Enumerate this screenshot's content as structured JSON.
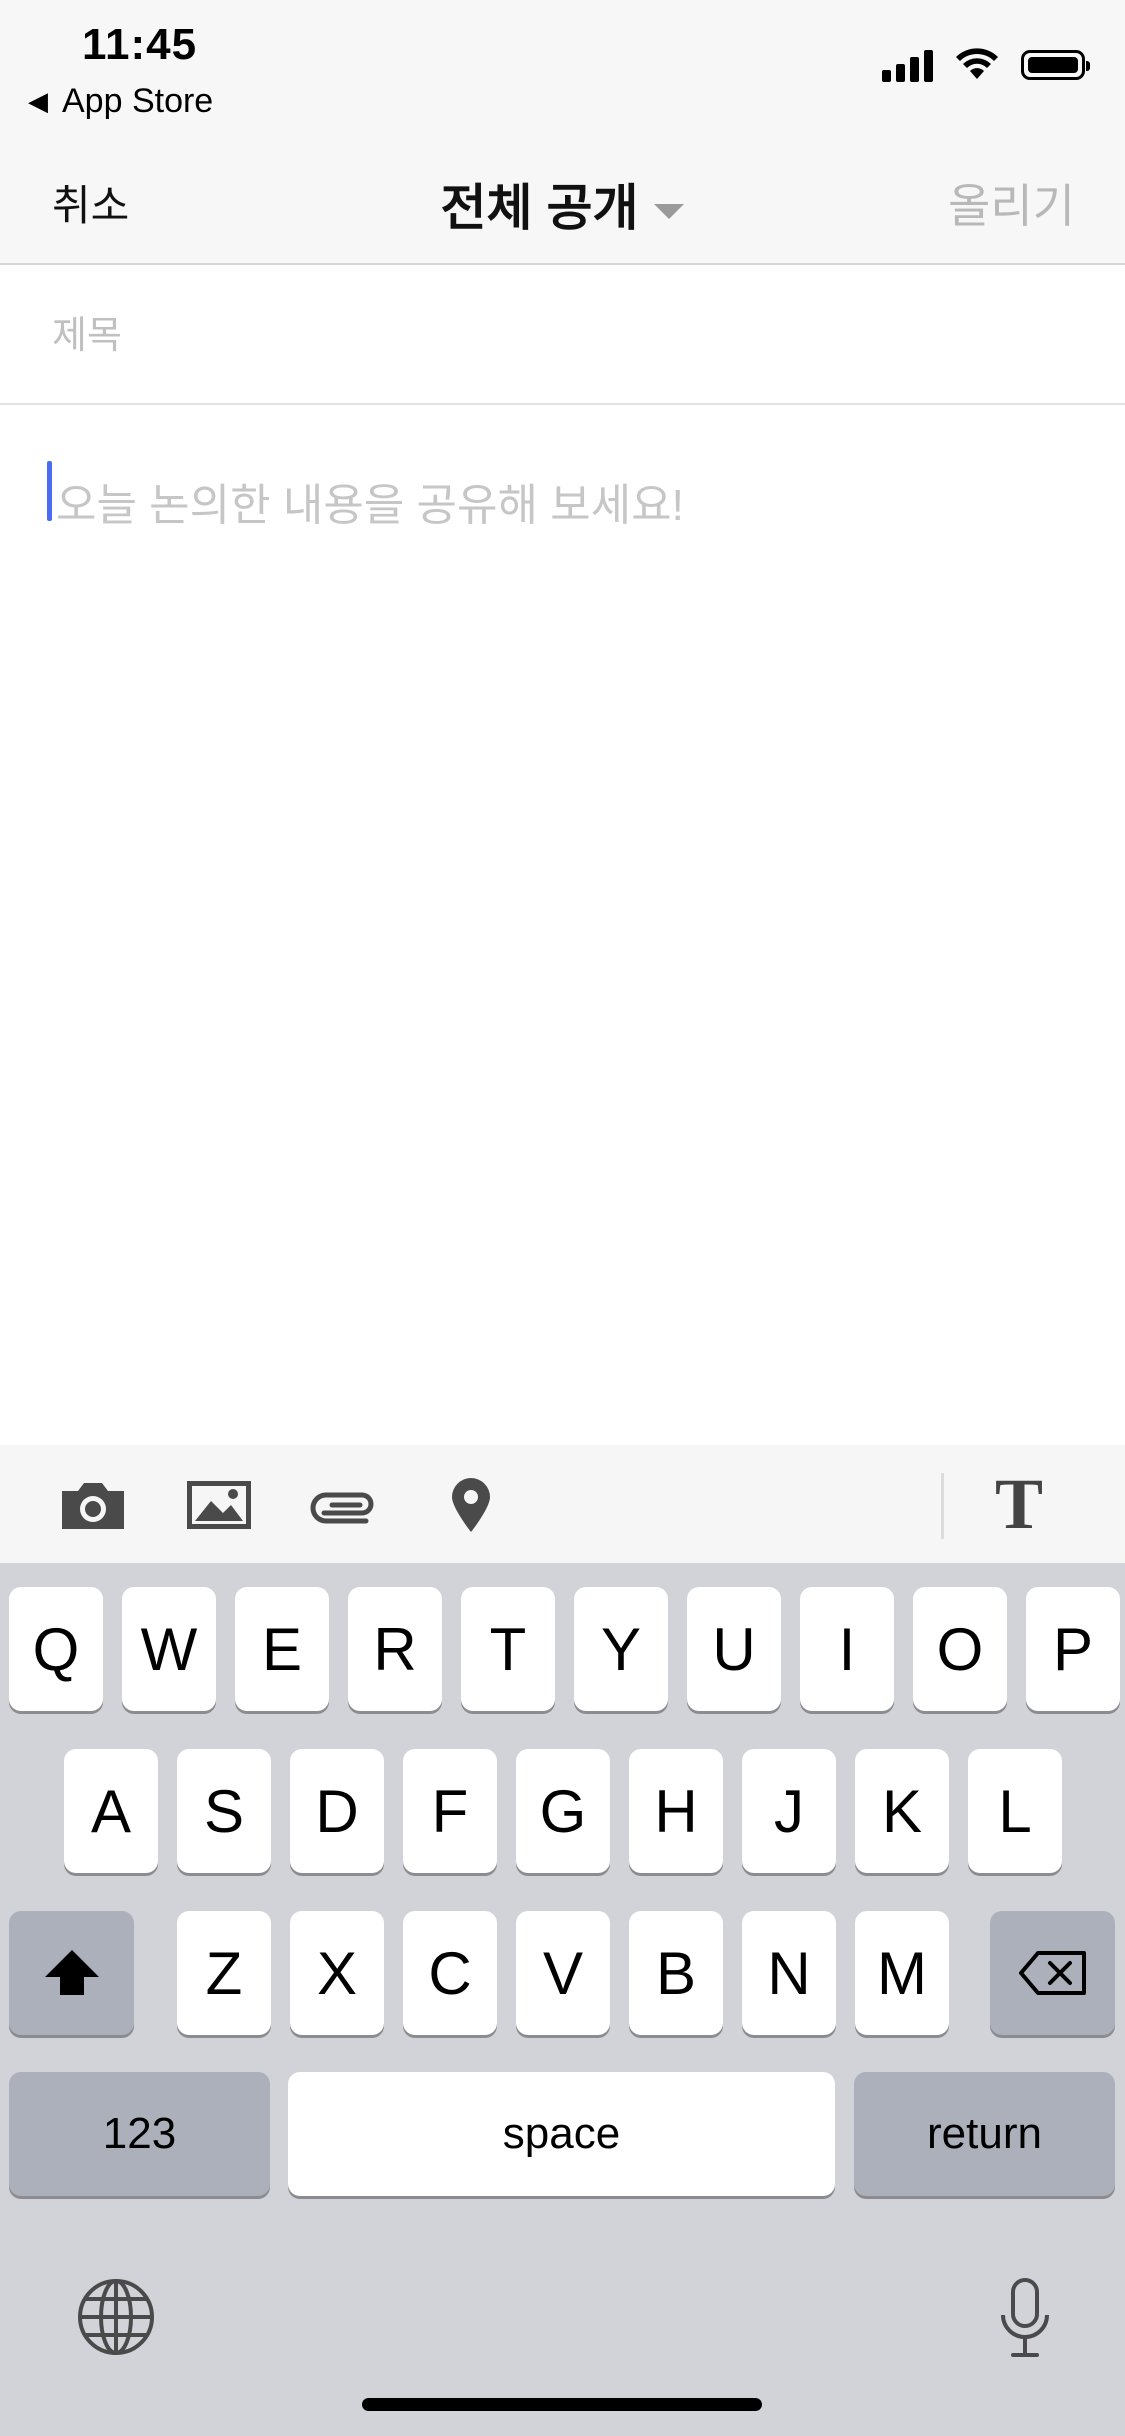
{
  "status_bar": {
    "time": "11:45",
    "back_app_label": "App Store",
    "icons": [
      "back-arrow-icon",
      "cellular-signal-icon",
      "wifi-icon",
      "battery-icon"
    ]
  },
  "nav": {
    "cancel_label": "취소",
    "title": "전체 공개",
    "post_label": "올리기"
  },
  "compose": {
    "title_placeholder": "제목",
    "body_placeholder": "오늘 논의한 내용을 공유해 보세요!",
    "caret_color": "#4a6cf0"
  },
  "toolbar": {
    "icons": [
      "camera-icon",
      "image-icon",
      "paperclip-icon",
      "location-pin-icon"
    ],
    "text_format_label": "T"
  },
  "keyboard": {
    "row1": [
      "Q",
      "W",
      "E",
      "R",
      "T",
      "Y",
      "U",
      "I",
      "O",
      "P"
    ],
    "row2": [
      "A",
      "S",
      "D",
      "F",
      "G",
      "H",
      "J",
      "K",
      "L"
    ],
    "row3": [
      "Z",
      "X",
      "C",
      "V",
      "B",
      "N",
      "M"
    ],
    "numbers_label": "123",
    "space_label": "space",
    "return_label": "return",
    "icons": [
      "shift-icon",
      "backspace-icon",
      "globe-icon",
      "microphone-icon"
    ]
  }
}
